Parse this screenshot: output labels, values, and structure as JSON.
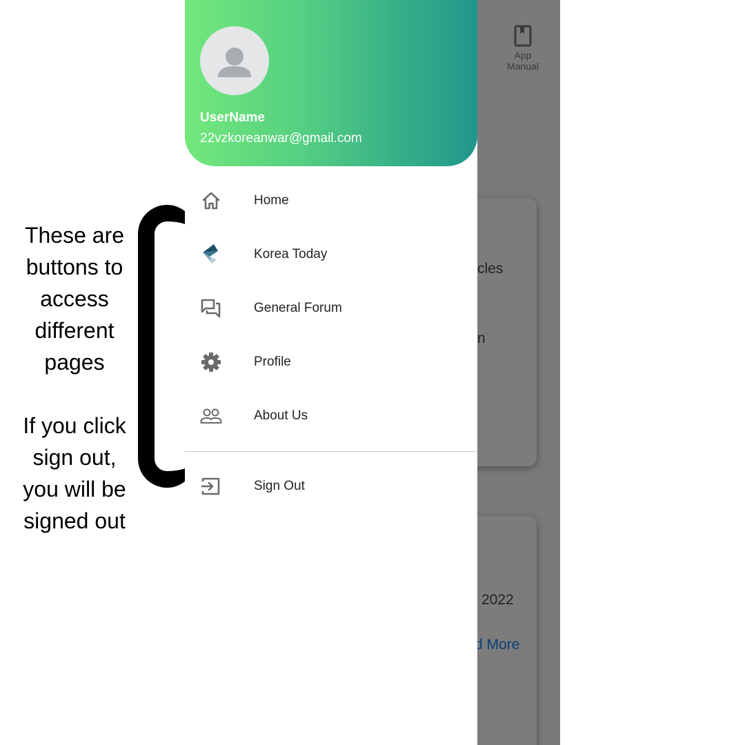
{
  "annotation": {
    "paragraph1": [
      "These are",
      "buttons to",
      "access",
      "different",
      "pages"
    ],
    "paragraph2": [
      "If you click",
      "sign out,",
      "you will be",
      "signed out"
    ]
  },
  "background_app": {
    "app_manual_label_line1": "App",
    "app_manual_label_line2": "Manual",
    "partial_text_1": "cles",
    "partial_text_2": "n",
    "partial_text_3": "2022",
    "partial_link": "d More"
  },
  "drawer": {
    "header": {
      "user_name": "UserName",
      "email": "22vzkoreanwar@gmail.com",
      "gradient": [
        "#72e87a",
        "#1f968c"
      ]
    },
    "menu": [
      {
        "label": "Home",
        "icon": "home-icon"
      },
      {
        "label": "Korea Today",
        "icon": "korea-today-logo-icon"
      },
      {
        "label": "General Forum",
        "icon": "forum-icon"
      },
      {
        "label": "Profile",
        "icon": "gear-icon"
      },
      {
        "label": "About Us",
        "icon": "people-icon"
      }
    ],
    "sign_out": {
      "label": "Sign Out",
      "icon": "sign-out-icon"
    }
  }
}
